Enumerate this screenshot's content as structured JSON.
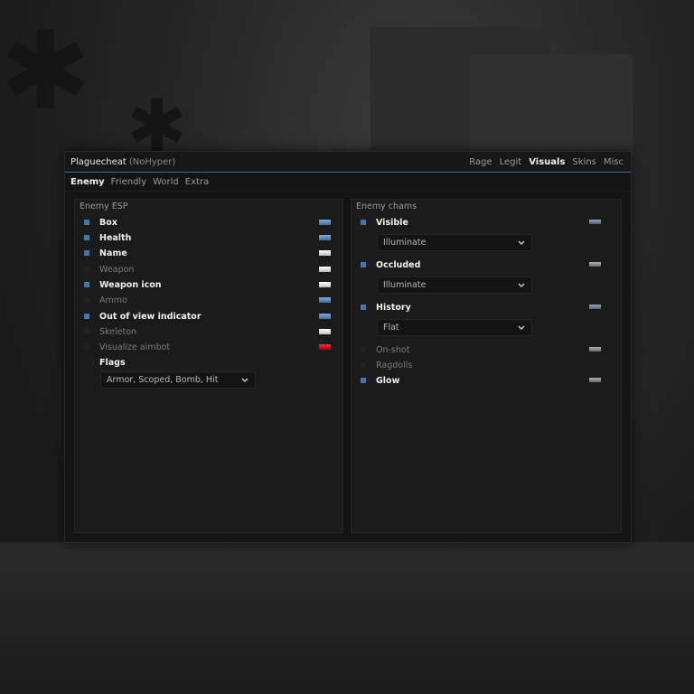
{
  "window": {
    "brand": "Plaguecheat",
    "brand_sub": "(NoHyper)",
    "main_tabs": [
      {
        "label": "Rage",
        "active": false
      },
      {
        "label": "Legit",
        "active": false
      },
      {
        "label": "Visuals",
        "active": true
      },
      {
        "label": "Skins",
        "active": false
      },
      {
        "label": "Misc",
        "active": false
      }
    ],
    "sub_tabs": [
      {
        "label": "Enemy",
        "active": true
      },
      {
        "label": "Friendly",
        "active": false
      },
      {
        "label": "World",
        "active": false
      },
      {
        "label": "Extra",
        "active": false
      }
    ]
  },
  "enemy_esp": {
    "title": "Enemy ESP",
    "items": [
      {
        "label": "Box",
        "checked": true,
        "color": "blue"
      },
      {
        "label": "Health",
        "checked": true,
        "color": "blue"
      },
      {
        "label": "Name",
        "checked": true,
        "color": "white"
      },
      {
        "label": "Weapon",
        "checked": false,
        "color": "white"
      },
      {
        "label": "Weapon icon",
        "checked": true,
        "color": "white"
      },
      {
        "label": "Ammo",
        "checked": false,
        "color": "blue"
      },
      {
        "label": "Out of view indicator",
        "checked": true,
        "color": "blue"
      },
      {
        "label": "Skeleton",
        "checked": false,
        "color": "white"
      },
      {
        "label": "Visualize aimbot",
        "checked": false,
        "color": "red"
      }
    ],
    "flags_label": "Flags",
    "flags_value": "Armor, Scoped, Bomb, Hit"
  },
  "enemy_chams": {
    "title": "Enemy chams",
    "visible_label": "Visible",
    "visible_material": "Illuminate",
    "occluded_label": "Occluded",
    "occluded_material": "Illuminate",
    "history_label": "History",
    "history_material": "Flat",
    "onshot_label": "On-shot",
    "ragdolls_label": "Ragdolls",
    "glow_label": "Glow"
  },
  "colors": {
    "accent": "#3c78b4",
    "swatch_blue": "#5a88c0",
    "swatch_white": "#e6e6e6",
    "swatch_red": "#d01010"
  }
}
